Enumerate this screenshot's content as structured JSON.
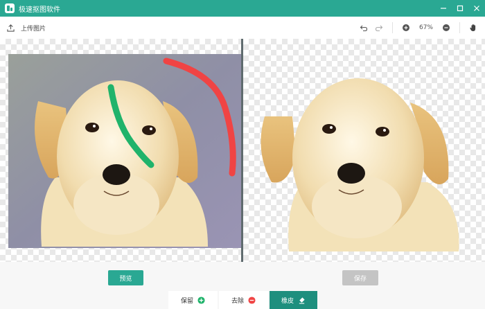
{
  "app": {
    "title": "极速抠图软件",
    "accent": "#2aa893"
  },
  "window_controls": [
    {
      "name": "minimize-icon"
    },
    {
      "name": "maximize-icon"
    },
    {
      "name": "close-icon"
    }
  ],
  "toolbar": {
    "upload_label": "上传图片",
    "upload_icon": "upload-icon",
    "zoom_level": "67%"
  },
  "footer": {
    "preview_label": "预览",
    "save_label": "保存",
    "keep_label": "保留",
    "remove_label": "去除",
    "eraser_label": "橡皮"
  },
  "colors": {
    "keep_stroke": "#20b36b",
    "remove_stroke": "#f04444",
    "save_disabled": "#c4c4c4",
    "eraser_active": "#1e8f7e"
  }
}
